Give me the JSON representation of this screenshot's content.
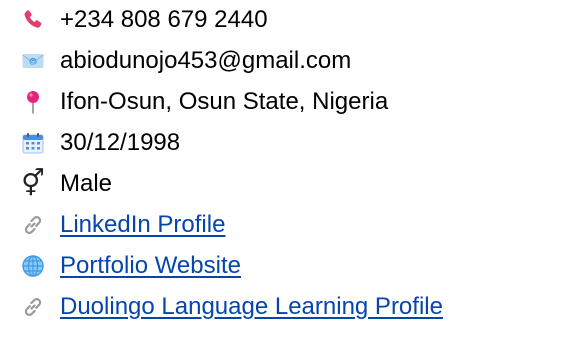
{
  "contact": {
    "phone": "+234 808 679 2440",
    "email": "abiodunojo453@gmail.com",
    "location": "Ifon-Osun, Osun State, Nigeria",
    "birthdate": "30/12/1998",
    "gender": "Male",
    "gender_glyph": "⚥",
    "linkedin_label": "LinkedIn Profile",
    "portfolio_label": "Portfolio Website",
    "duolingo_label": "Duolingo Language Learning Profile"
  },
  "icons": {
    "phone": "phone-icon",
    "email": "envelope-icon",
    "location": "map-pin-icon",
    "birthdate": "calendar-icon",
    "gender": "gender-icon",
    "linkedin": "link-icon",
    "portfolio": "globe-icon",
    "duolingo": "link-icon"
  },
  "colors": {
    "link": "#0645ad",
    "phone_icon": "#e53d6b",
    "pin_icon": "#e8247a",
    "calendar_icon": "#4a90e2",
    "globe_icon": "#3d9be9",
    "link_icon": "#9a9a9a"
  }
}
